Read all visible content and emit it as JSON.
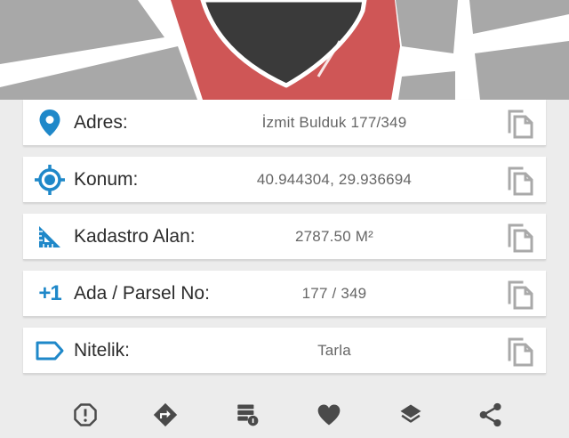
{
  "colors": {
    "accent": "#1f88c9",
    "icon_gray": "#a9a9a9",
    "toolbar_icon": "#4a4a4a",
    "map_red": "#cf5656",
    "map_road_gray": "#a8a8a8",
    "map_pin": "#3a3a3a"
  },
  "rows": [
    {
      "icon": "location-pin-icon",
      "label": "Adres:",
      "value": "İzmit Bulduk 177/349"
    },
    {
      "icon": "crosshair-target-icon",
      "label": "Konum:",
      "value": "40.944304, 29.936694"
    },
    {
      "icon": "ruler-triangle-icon",
      "label": "Kadastro Alan:",
      "value": "2787.50 M²"
    },
    {
      "icon": "plus-one-icon",
      "icon_text": "+1",
      "label": "Ada / Parsel No:",
      "value": "177 / 349"
    },
    {
      "icon": "label-tag-icon",
      "label": "Nitelik:",
      "value": "Tarla"
    }
  ],
  "toolbar": [
    {
      "icon": "report-alert-icon"
    },
    {
      "icon": "directions-icon"
    },
    {
      "icon": "info-database-icon"
    },
    {
      "icon": "favorite-heart-icon"
    },
    {
      "icon": "layers-icon"
    },
    {
      "icon": "share-icon"
    }
  ]
}
